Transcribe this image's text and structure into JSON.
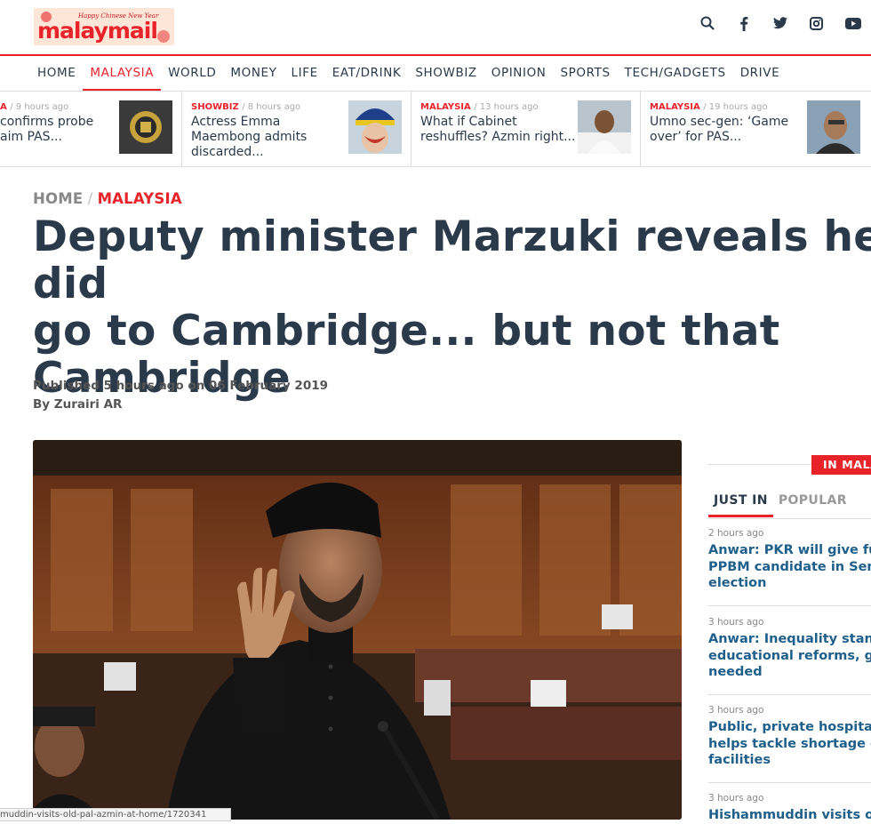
{
  "brand": {
    "name": "malay mail",
    "tagline": "Happy Chinese New Year"
  },
  "colors": {
    "accent": "#e8232a",
    "text": "#2b3a4a",
    "link": "#1f5f8b"
  },
  "social": [
    "search-icon",
    "facebook-icon",
    "twitter-icon",
    "instagram-icon",
    "youtube-icon"
  ],
  "nav": [
    "HOME",
    "MALAYSIA",
    "WORLD",
    "MONEY",
    "LIFE",
    "EAT/DRINK",
    "SHOWBIZ",
    "OPINION",
    "SPORTS",
    "TECH/GADGETS",
    "DRIVE"
  ],
  "ticker": [
    {
      "cat": "A",
      "time": "/ 9 hours ago",
      "title": "confirms probe\naim PAS..."
    },
    {
      "cat": "SHOWBIZ",
      "time": "/ 8 hours ago",
      "title": "Actress Emma\nMaembong admits\ndiscarded..."
    },
    {
      "cat": "MALAYSIA",
      "time": "/ 13 hours ago",
      "title": "What if Cabinet\nreshuffles? Azmin right..."
    },
    {
      "cat": "MALAYSIA",
      "time": "/ 19 hours ago",
      "title": "Umno sec-gen: ‘Game\nover’ for PAS..."
    }
  ],
  "breadcrumb": {
    "home": "HOME",
    "sep": "/",
    "current": "MALAYSIA"
  },
  "article": {
    "headline": "Deputy minister Marzuki reveals he did\ngo to Cambridge... but not that\nCambridge",
    "published": "Published 5 hours ago on 06 February 2019",
    "byline": "By Zurairi AR"
  },
  "sidebar": {
    "section_label": "IN MALAYSIA",
    "tabs": [
      "JUST IN",
      "POPULAR"
    ],
    "stories": [
      {
        "time": "2 hours ago",
        "title": "Anwar: PKR will give full s\nPPBM candidate in Semen\nelection"
      },
      {
        "time": "3 hours ago",
        "title": "Anwar: Inequality stands\neducational reforms, govt\nneeded"
      },
      {
        "time": "3 hours ago",
        "title": "Public, private hospitals c\nhelps tackle shortage of s\nfacilities"
      },
      {
        "time": "3 hours ago",
        "title": "Hishammuddin visits old r"
      }
    ]
  },
  "status_url": "muddin-visits-old-pal-azmin-at-home/1720341"
}
